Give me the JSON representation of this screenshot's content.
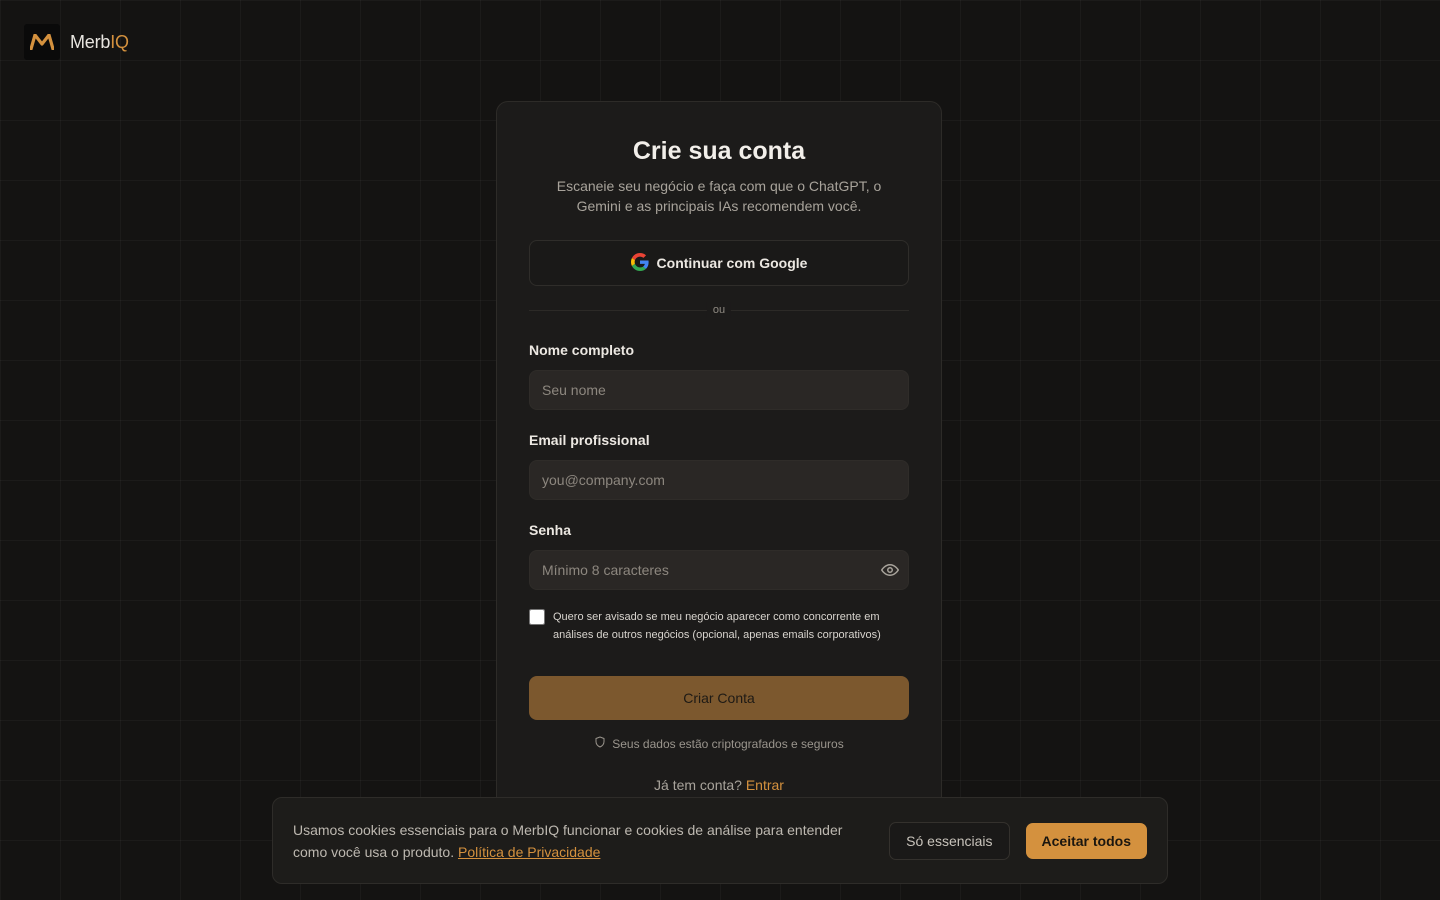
{
  "brand": {
    "name_main": "Merb",
    "name_accent": "IQ",
    "accent_color": "#d4913e"
  },
  "signup": {
    "title": "Crie sua conta",
    "subtitle": "Escaneie seu negócio e faça com que o ChatGPT, o Gemini e as principais IAs recomendem você.",
    "google_button_label": "Continuar com Google",
    "divider_text": "ou",
    "fields": {
      "name": {
        "label": "Nome completo",
        "placeholder": "Seu nome",
        "value": ""
      },
      "email": {
        "label": "Email profissional",
        "placeholder": "you@company.com",
        "value": ""
      },
      "password": {
        "label": "Senha",
        "placeholder": "Mínimo 8 caracteres",
        "value": ""
      }
    },
    "competitor_alert": {
      "checked": false,
      "label": "Quero ser avisado se meu negócio aparecer como concorrente em análises de outros negócios (opcional, apenas emails corporativos)"
    },
    "create_button_label": "Criar Conta",
    "secure_note": "Seus dados estão criptografados e seguros",
    "login_prompt": "Já tem conta?",
    "login_link": "Entrar"
  },
  "cookie_banner": {
    "text": "Usamos cookies essenciais para o MerbIQ funcionar e cookies de análise para entender como você usa o produto.",
    "policy_link": "Política de Privacidade",
    "essential_button": "Só essenciais",
    "accept_button": "Aceitar todos"
  }
}
